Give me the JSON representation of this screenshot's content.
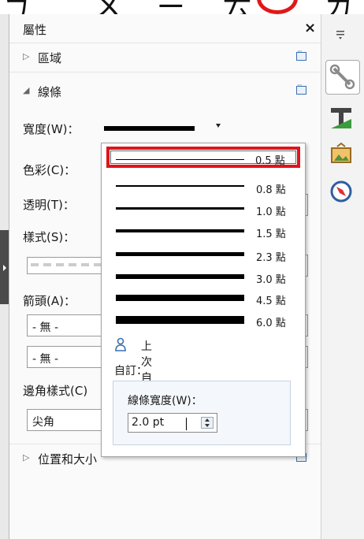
{
  "top_strip": {
    "glyphs": [
      "ㄅ",
      "ㄨ",
      "ㄧ",
      "ㄊ",
      "ㄌ"
    ]
  },
  "panel": {
    "title": "屬性",
    "close": "×",
    "sections": {
      "region": "區域",
      "line": "線條",
      "position_size": "位置和大小"
    },
    "fields": {
      "width_label": "寬度(W)：",
      "color_label": "色彩(C)：",
      "transparency_label": "透明(T)：",
      "style_label": "樣式(S)：",
      "arrowhead_label": "箭頭(A)：",
      "arrow_start_value": "- 無 -",
      "arrow_end_value": "- 無 -",
      "corner_label": "邊角樣式(C)",
      "corner_value": "尖角"
    }
  },
  "width_dropdown": {
    "options": [
      {
        "label": "0.5 點",
        "thickness_pt": 0.5,
        "selected": true
      },
      {
        "label": "0.8 點",
        "thickness_pt": 0.8
      },
      {
        "label": "1.0 點",
        "thickness_pt": 1.0
      },
      {
        "label": "1.5 點",
        "thickness_pt": 1.5
      },
      {
        "label": "2.3 點",
        "thickness_pt": 2.3
      },
      {
        "label": "3.0 點",
        "thickness_pt": 3.0
      },
      {
        "label": "4.5 點",
        "thickness_pt": 4.5
      },
      {
        "label": "6.0 點",
        "thickness_pt": 6.0
      }
    ],
    "last_custom": "上次自訂值",
    "custom_header": "自訂：",
    "custom_width_label": "線條寬度(W)：",
    "custom_width_value": "2.0 pt"
  },
  "colors": {
    "highlight": "#e0141a",
    "accent": "#3a6fb0"
  },
  "sidebar_icons": [
    "properties-icon",
    "styles-icon",
    "gallery-icon",
    "navigator-icon"
  ]
}
